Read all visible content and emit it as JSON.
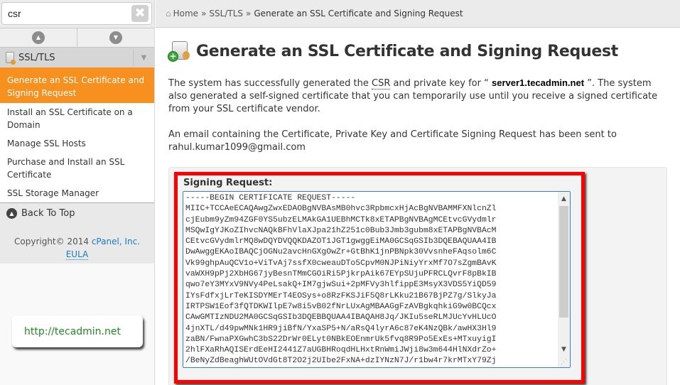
{
  "sidebar": {
    "search": {
      "value": "csr",
      "clear_icon": "✖"
    },
    "nav_up_icon": "▲",
    "nav_down_icon": "▼",
    "group": {
      "label": "SSL/TLS",
      "caret": "▼"
    },
    "items": [
      {
        "label": "Generate an SSL Certificate and Signing Request",
        "active": true
      },
      {
        "label": "Install an SSL Certificate on a Domain",
        "active": false
      },
      {
        "label": "Manage SSL Hosts",
        "active": false
      },
      {
        "label": "Purchase and Install an SSL Certificate",
        "active": false
      },
      {
        "label": "SSL Storage Manager",
        "active": false
      }
    ],
    "back_to_top": "Back To Top",
    "copyright_prefix": "Copyright© 2014",
    "copyright_link": "cPanel, Inc.",
    "eula": "EULA"
  },
  "watermark": "http://tecadmin.net",
  "breadcrumb": {
    "home_icon": "⌂",
    "home": "Home",
    "separator": "»",
    "section": "SSL/TLS",
    "current": "Generate an SSL Certificate and Signing Request"
  },
  "page": {
    "title": "Generate an SSL Certificate and Signing Request",
    "para1_a": "The system has successfully generated the ",
    "para1_csr": "CSR",
    "para1_b": " and private key for “ ",
    "hostname": "server1.tecadmin.net",
    "para1_c": " ”. The system also generated a self-signed certificate that you can temporarily use until you receive a signed certificate from your SSL certificate vendor.",
    "para2": "An email containing the Certificate, Private Key and Certificate Signing Request has been sent to rahul.kumar1099@gmail.com",
    "signing_request_label": "Signing Request:",
    "csr_text": "-----BEGIN CERTIFICATE REQUEST-----\nMIIC+TCCAeECAQAwgZwxEDAOBgNVBAsMB0hvc3RpbmcxHjAcBgNVBAMMFXNlcnZl\ncjEubm9yZm94ZGF0YS5ubzELMAkGA1UEBhMCTk8xETAPBgNVBAgMCEtvcGVydmlr\nMSQwIgYJKoZIhvcNAQkBFhVlaXJpa21hZ251c0Bub3Jmb3gubm8xETAPBgNVBAcM\nCEtvcGVydmlrMQ8wDQYDVQQKDAZOT1JGT1gwggEiMA0GCSqGSIb3DQEBAQUAA4IB\nDwAwggEKAoIBAQCjOGNu2avcHnGXgOwZr+GtBhK1jnPBNpk30VvsnheFAqsolm6C\nVk99ghpAuQCV1o+ViTvAj7ssfX0cweauDTo5CpvM0NJPiNiyYrxMf7O7sZgmBAvK\nvaWXH9pPj2XbHG67jyBesnTMmCGOiRi5PjkrpAik67EYpSUjuPFRCLQvrF8pBkIB\nqwo7eY3MYxV9NVy4PeLsakQ+IM7gjwSui+2pMFVy3hlfippE3MsyX3VDS5YiQD59\nIYsFdfxjLrTeKISDYMErT4EOSys+o8RzFKSJiF5Q8rLKku21B67BjPZ7g/SlkyJa\nIRTPSW1Eof3fQTDKWIlpE7w8i5vB02fNrLUxAgMBAAGgFzAVBgkqhkiG9w0BCQcx\nCAwGMTIzNDU2MA0GCSqGSIb3DQEBBQUAA4IBAQAH8Jq/JKIu5seRLMJUcYvHLUcO\n4jnXTL/d49pwMNk1HR9jiBfN/YxaSP5+N/aRsQ4lyrA6c87eK4NzQBk/awHX3Hl9\nzaBN/FwnaPXGwhC3bS22DrWr0ELyt0NBkEOEnmrUk5fvq8R9Po5ExEs+MTxuyigI\n2hlFXaRhAQISErdEeHI2441Z7aUGBHRoqdHLHxtRnWmiJWji8w3m644HlNXdrZo+\n/BeNyZdBeaghWUtOVdGt8T2O2j2UIbe2FxNA+dzIYNzN7J/r1bw4r7krMTxY79Zj"
  },
  "colors": {
    "accent": "#f7901e",
    "link": "#1a7cc1",
    "highlight_border": "#ff0000",
    "watermark_text": "#1e8c1e"
  }
}
